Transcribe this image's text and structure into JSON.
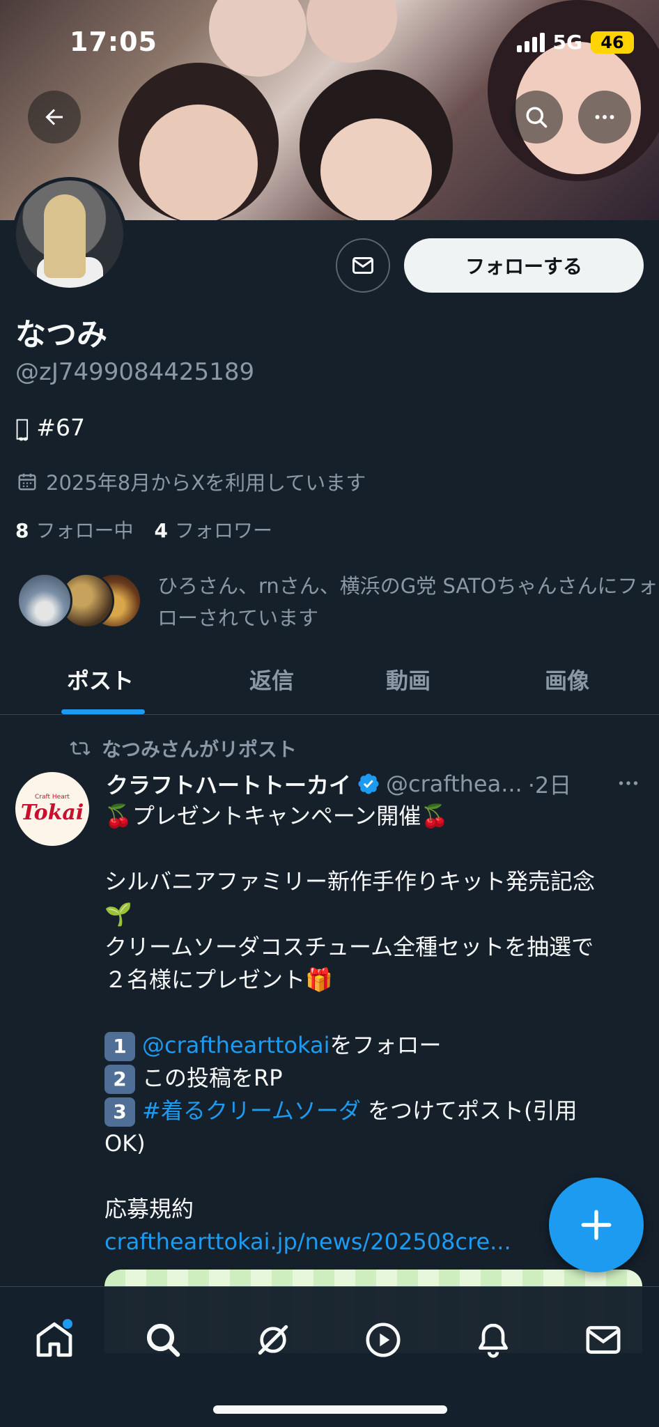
{
  "status_bar": {
    "time": "17:05",
    "network": "5G",
    "battery": "46"
  },
  "profile": {
    "display_name": "なつみ",
    "handle": "@zJ7499084425189",
    "bio": "ꪔ̤̫ #67",
    "joined": "2025年8月からXを利用しています",
    "following_count": "8",
    "following_label": "フォロー中",
    "followers_count": "4",
    "followers_label": "フォロワー",
    "follow_button": "フォローする",
    "followed_by": "ひろさん、rnさん、横浜のG党 SATOちゃんさんにフォローされています"
  },
  "tabs": [
    {
      "label": "ポスト",
      "active": true
    },
    {
      "label": "返信",
      "active": false
    },
    {
      "label": "動画",
      "active": false
    },
    {
      "label": "画像",
      "active": false
    }
  ],
  "post": {
    "repost_label": "なつみさんがリポスト",
    "author_name": "クラフトハートトーカイ",
    "author_handle": "@crafthea...",
    "time": "·2日",
    "avatar_logo": "Tokai",
    "avatar_logo_small": "Craft Heart",
    "lines": [
      "🍒プレゼントキャンペーン開催🍒",
      "",
      "シルバニアファミリー新作手作りキット発売記念",
      "🌱",
      "クリームソーダコスチューム全種セットを抽選で",
      "２名様にプレゼント🎁",
      ""
    ],
    "step1_num": "1",
    "step1_link": "@crafthearttokai",
    "step1_text": "をフォロー",
    "step2_num": "2",
    "step2_text": "この投稿をRP",
    "step3_num": "3",
    "step3_link": "#着るクリームソーダ",
    "step3_text": " をつけてポスト(引用",
    "step3_cont": "OK)",
    "rules_label": "応募規約",
    "rules_link": "crafthearttokai.jp/news/202508cre..."
  },
  "nav": [
    "home-icon",
    "search-icon",
    "grok-icon",
    "video-icon",
    "notifications-icon",
    "messages-icon"
  ],
  "colors": {
    "background": "#15202b",
    "accent": "#1d9bf0",
    "secondary_text": "#8b98a5"
  }
}
